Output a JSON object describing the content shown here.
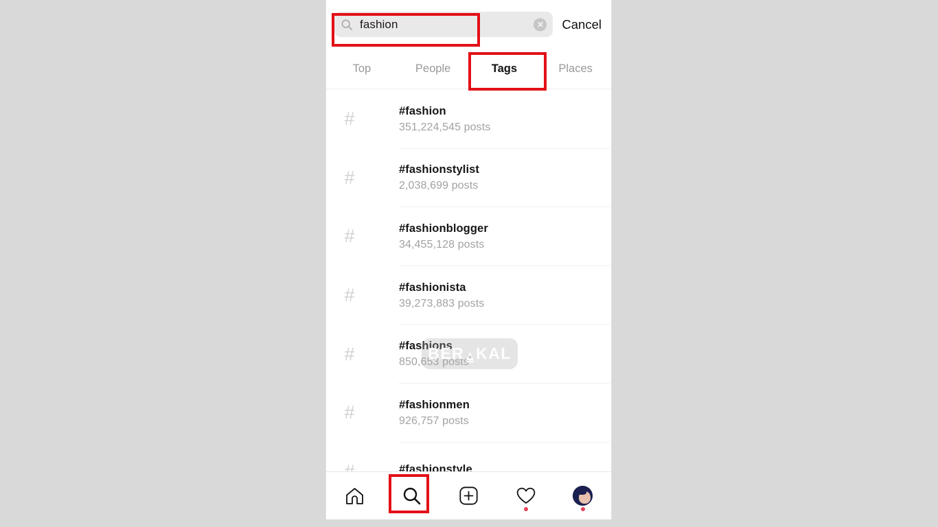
{
  "colors": {
    "page_background": "#d9d9d9",
    "annotation_red": "#e31016",
    "search_field_bg": "#e9e9e9",
    "active_tab_text": "#111111",
    "inactive_tab_text": "#9a9a9a",
    "muted_text": "#a2a2a2",
    "notification_dot": "#e8445a"
  },
  "search": {
    "icon": "search-icon",
    "value": "fashion",
    "placeholder": "Search",
    "clear_icon": "clear-circle-x-icon",
    "cancel_label": "Cancel"
  },
  "tabs": [
    {
      "label": "Top",
      "active": false
    },
    {
      "label": "People",
      "active": false
    },
    {
      "label": "Tags",
      "active": true
    },
    {
      "label": "Places",
      "active": false
    }
  ],
  "results": [
    {
      "icon": "hashtag-icon",
      "tag": "#fashion",
      "count": "351,224,545 posts"
    },
    {
      "icon": "hashtag-icon",
      "tag": "#fashionstylist",
      "count": "2,038,699 posts"
    },
    {
      "icon": "hashtag-icon",
      "tag": "#fashionblogger",
      "count": "34,455,128 posts"
    },
    {
      "icon": "hashtag-icon",
      "tag": "#fashionista",
      "count": "39,273,883 posts"
    },
    {
      "icon": "hashtag-icon",
      "tag": "#fashions",
      "count": "850,653 posts"
    },
    {
      "icon": "hashtag-icon",
      "tag": "#fashionmen",
      "count": "926,757 posts"
    },
    {
      "icon": "hashtag-icon",
      "tag": "#fashionstyle",
      "count": ""
    }
  ],
  "watermark": {
    "text_before": "BER",
    "text_after": "KAL",
    "mark": "berakal-logo-icon"
  },
  "bottom_nav": [
    {
      "name": "home-icon",
      "label": "Home",
      "badge": false,
      "active": false
    },
    {
      "name": "search-icon",
      "label": "Search",
      "badge": false,
      "active": true
    },
    {
      "name": "add-post-icon",
      "label": "Create",
      "badge": false,
      "active": false
    },
    {
      "name": "heart-icon",
      "label": "Activity",
      "badge": true,
      "active": false
    },
    {
      "name": "profile-avatar",
      "label": "Profile",
      "badge": true,
      "active": false
    }
  ],
  "annotations": [
    {
      "name": "search-field-highlight",
      "target": "search-input"
    },
    {
      "name": "tags-tab-highlight",
      "target": "tab-tags"
    },
    {
      "name": "search-nav-highlight",
      "target": "nav-search"
    }
  ]
}
